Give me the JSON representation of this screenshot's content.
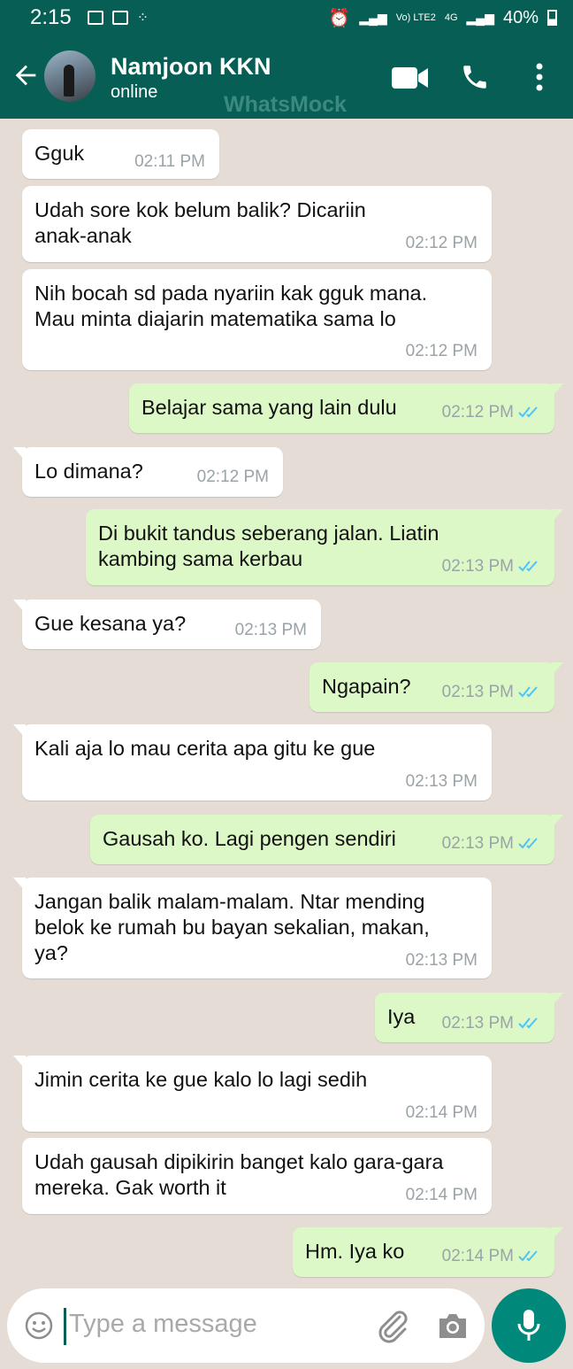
{
  "status_bar": {
    "time": "2:15",
    "network": "Vo) LTE2",
    "network_4g": "4G",
    "battery": "40%"
  },
  "header": {
    "contact_name": "Namjoon KKN",
    "status": "online",
    "watermark": "WhatsMock",
    "icons": [
      "back-arrow-icon",
      "video-call-icon",
      "voice-call-icon",
      "more-options-icon"
    ]
  },
  "messages": [
    {
      "dir": "in",
      "lines": [
        "Gguk"
      ],
      "time": "02:11 PM"
    },
    {
      "dir": "in",
      "lines": [
        "Udah sore kok belum balik? Dicariin",
        "anak-anak"
      ],
      "time": "02:12 PM"
    },
    {
      "dir": "in",
      "lines": [
        "Nih bocah sd pada nyariin kak gguk mana.",
        "Mau minta diajarin matematika sama lo"
      ],
      "time": "02:12 PM"
    },
    {
      "dir": "out",
      "lines": [
        "Belajar sama yang lain dulu"
      ],
      "time": "02:12 PM"
    },
    {
      "dir": "in",
      "lines": [
        "Lo dimana?"
      ],
      "time": "02:12 PM"
    },
    {
      "dir": "out",
      "lines": [
        "Di bukit tandus seberang jalan. Liatin",
        "kambing sama kerbau"
      ],
      "time": "02:13 PM"
    },
    {
      "dir": "in",
      "lines": [
        "Gue kesana ya?"
      ],
      "time": "02:13 PM"
    },
    {
      "dir": "out",
      "lines": [
        "Ngapain?"
      ],
      "time": "02:13 PM"
    },
    {
      "dir": "in",
      "lines": [
        "Kali aja lo mau cerita apa gitu ke gue"
      ],
      "time": "02:13 PM"
    },
    {
      "dir": "out",
      "lines": [
        "Gausah ko. Lagi pengen sendiri"
      ],
      "time": "02:13 PM"
    },
    {
      "dir": "in",
      "lines": [
        "Jangan balik malam-malam. Ntar mending",
        "belok ke rumah bu bayan sekalian, makan,",
        "ya?"
      ],
      "time": "02:13 PM"
    },
    {
      "dir": "out",
      "lines": [
        "Iya"
      ],
      "time": "02:13 PM"
    },
    {
      "dir": "in",
      "lines": [
        "Jimin cerita ke gue kalo lo lagi sedih"
      ],
      "time": "02:14 PM"
    },
    {
      "dir": "in",
      "lines": [
        "Udah gausah dipikirin banget kalo gara-gara",
        "mereka. Gak worth it"
      ],
      "time": "02:14 PM"
    },
    {
      "dir": "out",
      "lines": [
        "Hm. Iya ko"
      ],
      "time": "02:14 PM"
    }
  ],
  "composer": {
    "placeholder": "Type a message",
    "icons": [
      "emoji-icon",
      "attach-icon",
      "camera-icon",
      "mic-icon"
    ]
  },
  "colors": {
    "header": "#075e54",
    "incoming_bubble": "#ffffff",
    "outgoing_bubble": "#dcf8c6",
    "read_tick": "#4fc3f7",
    "mic_button": "#00897b"
  }
}
